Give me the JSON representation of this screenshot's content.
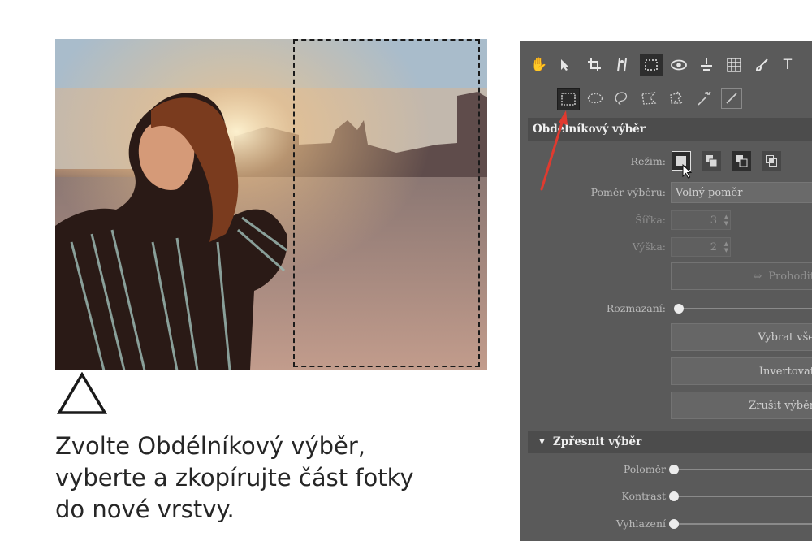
{
  "caption": {
    "line1": "Zvolte Obdélníkový výběr,",
    "line2": "vyberte a zkopírujte část fotky",
    "line3": "do nové vrstvy."
  },
  "toolbar": {
    "tools": [
      "hand-icon",
      "pointer-icon",
      "crop-icon",
      "straighten-icon",
      "selection-icon",
      "eye-icon",
      "level-icon",
      "grid-icon",
      "brush-icon",
      "text-icon"
    ],
    "active_tool": "selection-icon",
    "text_tool_label": "T",
    "selection_tools": [
      "rectangle-select-icon",
      "ellipse-select-icon",
      "lasso-icon",
      "polygon-lasso-icon",
      "magnetic-lasso-icon",
      "magic-wand-icon",
      "brush-select-icon"
    ],
    "active_selection_tool": "rectangle-select-icon"
  },
  "rect_selection": {
    "title": "Obdelníkový výběr",
    "mode_label": "Režim:",
    "ratio_label": "Poměr výběru:",
    "ratio_value": "Volný poměr",
    "width_label": "Šířka:",
    "width_value": "3",
    "height_label": "Výška:",
    "height_value": "2",
    "swap_label": "Prohodit",
    "blur_label": "Rozmazaní:",
    "select_all_label": "Vybrat vše",
    "invert_label": "Invertovat",
    "deselect_label": "Zrušit výběr"
  },
  "refine": {
    "title": "Zpřesnit výběr",
    "radius_label": "Poloměr",
    "contrast_label": "Kontrast",
    "smooth_label": "Vyhlazení"
  },
  "colors": {
    "panel_bg": "#5a5a5a",
    "section_bg": "#4c4c4c",
    "annotation_arrow": "#e03a2f",
    "caption_text": "#262626"
  }
}
